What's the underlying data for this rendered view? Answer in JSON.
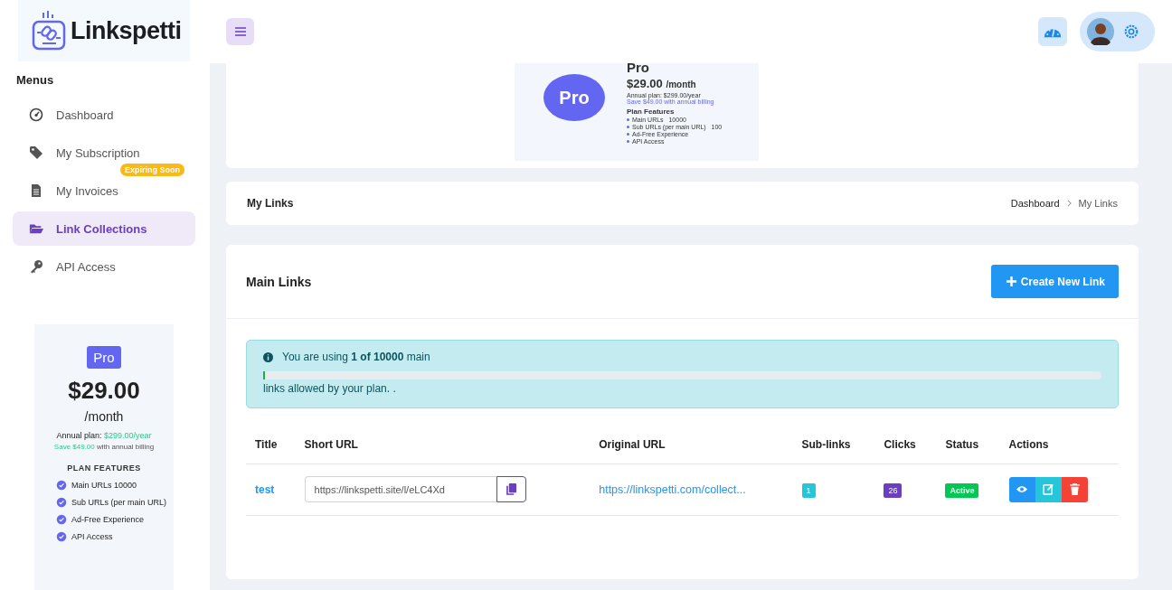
{
  "brand": {
    "name": "Linkspetti"
  },
  "sidebar": {
    "heading": "Menus",
    "items": [
      {
        "label": "Dashboard",
        "selected": false
      },
      {
        "label": "My Subscription",
        "selected": false,
        "badge": "Expiring Soon"
      },
      {
        "label": "My Invoices",
        "selected": false
      },
      {
        "label": "Link Collections",
        "selected": true
      },
      {
        "label": "API Access",
        "selected": false
      }
    ],
    "plan_card": {
      "badge": "Pro",
      "price": "$29.00",
      "period": "/month",
      "annual_label": "Annual plan:",
      "annual_price": "$299.00/year",
      "savings": "Save $49.00",
      "savings_rest": "with annual billing",
      "features_heading": "PLAN FEATURES",
      "features": [
        "Main URLs 10000",
        "Sub URLs (per main URL)",
        "Ad-Free Experience",
        "API Access"
      ]
    }
  },
  "top_banner": {
    "circle": "Pro",
    "title": "Pro",
    "price": "$29.00",
    "period": "/month",
    "annual": "Annual plan: $299.00/year",
    "savings": "Save $49.00 with annual billing",
    "features_heading": "Plan Features",
    "features": [
      {
        "name": "Main URLs",
        "value": "10000"
      },
      {
        "name": "Sub URLs (per main URL)",
        "value": "100"
      },
      {
        "name": "Ad-Free Experience"
      },
      {
        "name": "API Access"
      }
    ]
  },
  "page_header": {
    "title": "My Links",
    "breadcrumbs": [
      "Dashboard",
      "My Links"
    ]
  },
  "links_card": {
    "title": "Main Links",
    "create_button": "Create New Link",
    "alert": {
      "text": "You are using **1 of 10000** main",
      "level": 0.0001,
      "text_after": "links allowed by your plan. ."
    },
    "table": {
      "columns": [
        "Title",
        "Short URL",
        "Original URL",
        "Sub-links",
        "Clicks",
        "Status",
        "Actions"
      ],
      "rows": [
        {
          "title": "test",
          "short_url": "https://linkspetti.site/l/eLC4Xd",
          "original_url": "https://linkspetti.com/collect...",
          "sub_links": "1",
          "clicks": "26",
          "status": "Active"
        }
      ]
    }
  }
}
